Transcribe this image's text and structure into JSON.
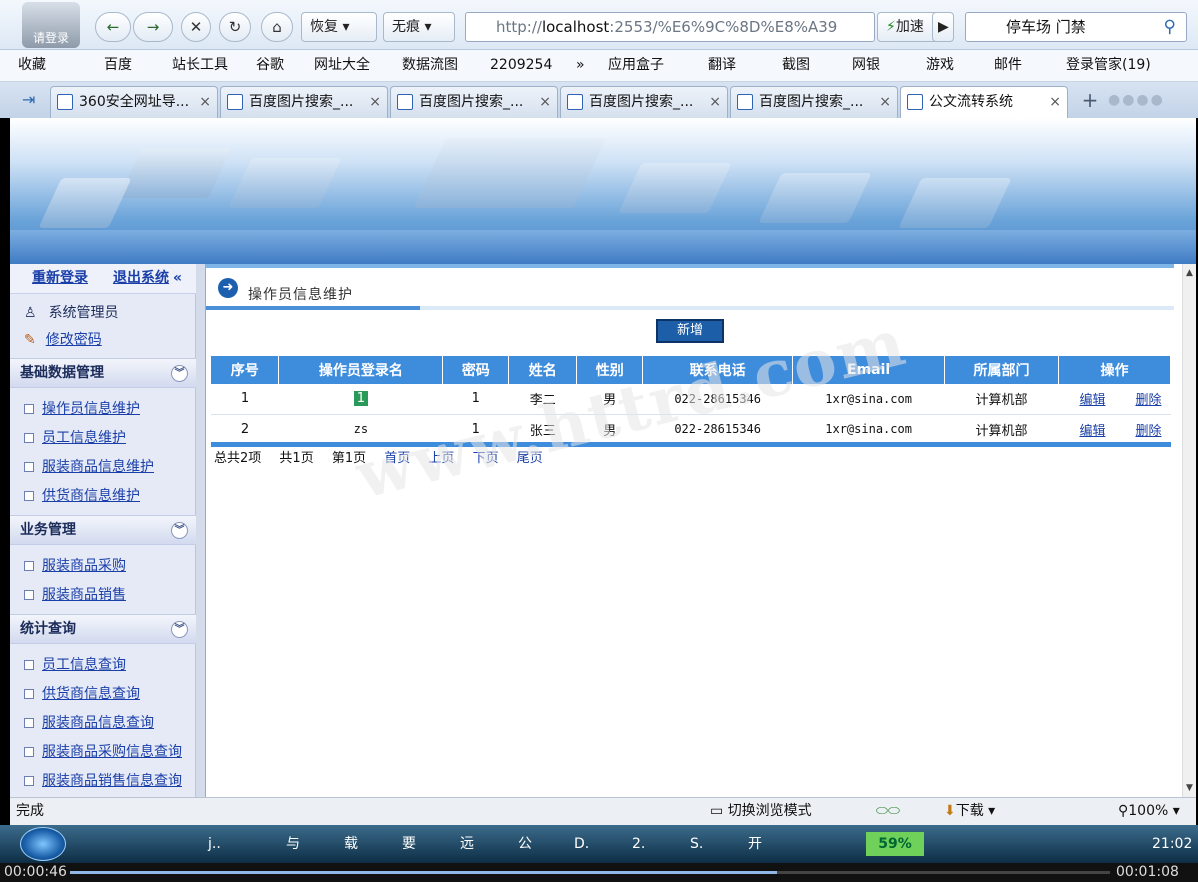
{
  "browser": {
    "avatar_label": "请登录",
    "nav": {
      "back": "←",
      "forward": "→",
      "stop": "✕",
      "refresh": "↻",
      "home": "⌂"
    },
    "restore_label": "恢复",
    "noimg_label": "无痕",
    "url_prefix": "http://",
    "url_host": "localhost",
    "url_rest": ":2553/%E6%9C%8D%E8%A39",
    "speed_label": "加速",
    "search_value": "停车场 门禁",
    "favorites": [
      "收藏",
      "百度",
      "站长工具",
      "谷歌",
      "网址大全",
      "数据流图",
      "2209254",
      "»",
      "应用盒子",
      "翻译",
      "截图",
      "网银",
      "游戏",
      "邮件",
      "登录管家(19)"
    ],
    "tabs": [
      {
        "label": "360安全网址导..."
      },
      {
        "label": "百度图片搜索_..."
      },
      {
        "label": "百度图片搜索_..."
      },
      {
        "label": "百度图片搜索_..."
      },
      {
        "label": "百度图片搜索_..."
      },
      {
        "label": "公文流转系统"
      }
    ],
    "tab_close": "×",
    "new_tab": "+"
  },
  "sidebar": {
    "relogin": "重新登录",
    "logout": "退出系统",
    "collapse": "«",
    "user": "系统管理员",
    "change_pwd": "修改密码",
    "sections": [
      {
        "title": "基础数据管理",
        "items": [
          "操作员信息维护",
          "员工信息维护",
          "服装商品信息维护",
          "供货商信息维护"
        ]
      },
      {
        "title": "业务管理",
        "items": [
          "服装商品采购",
          "服装商品销售"
        ]
      },
      {
        "title": "统计查询",
        "items": [
          "员工信息查询",
          "供货商信息查询",
          "服装商品信息查询",
          "服装商品采购信息查询",
          "服装商品销售信息查询"
        ]
      }
    ],
    "chev": "»"
  },
  "content": {
    "page_title": "操作员信息维护",
    "add_button": "新增",
    "columns": [
      "序号",
      "操作员登录名",
      "密码",
      "姓名",
      "性别",
      "联系电话",
      "Email",
      "所属部门",
      "操作"
    ],
    "rows": [
      {
        "no": "1",
        "login": "1",
        "pwd": "1",
        "name": "李二",
        "sex": "男",
        "phone": "022-28615346",
        "email": "1xr@sina.com",
        "dept": "计算机部",
        "edit": "编辑",
        "del": "删除"
      },
      {
        "no": "2",
        "login": "zs",
        "pwd": "1",
        "name": "张三",
        "sex": "男",
        "phone": "022-28615346",
        "email": "1xr@sina.com",
        "dept": "计算机部",
        "edit": "编辑",
        "del": "删除"
      }
    ],
    "pager": {
      "total": "总共2项",
      "pages": "共1页",
      "current": "第1页",
      "first": "首页",
      "prev": "上页",
      "next": "下页",
      "last": "尾页"
    },
    "watermark": "www.httrd.com"
  },
  "statusbar": {
    "left": "完成",
    "mode": "切换浏览模式",
    "download": "下载",
    "zoom": "100%"
  },
  "taskbar": {
    "items": [
      "j..",
      "与",
      "载",
      "要",
      "远",
      "公",
      "D.",
      "2.",
      "S.",
      "开"
    ],
    "battery": "59%",
    "time": "21:02"
  },
  "video": {
    "elapsed": "00:00:46",
    "total": "00:01:08",
    "progress": 0.68
  }
}
